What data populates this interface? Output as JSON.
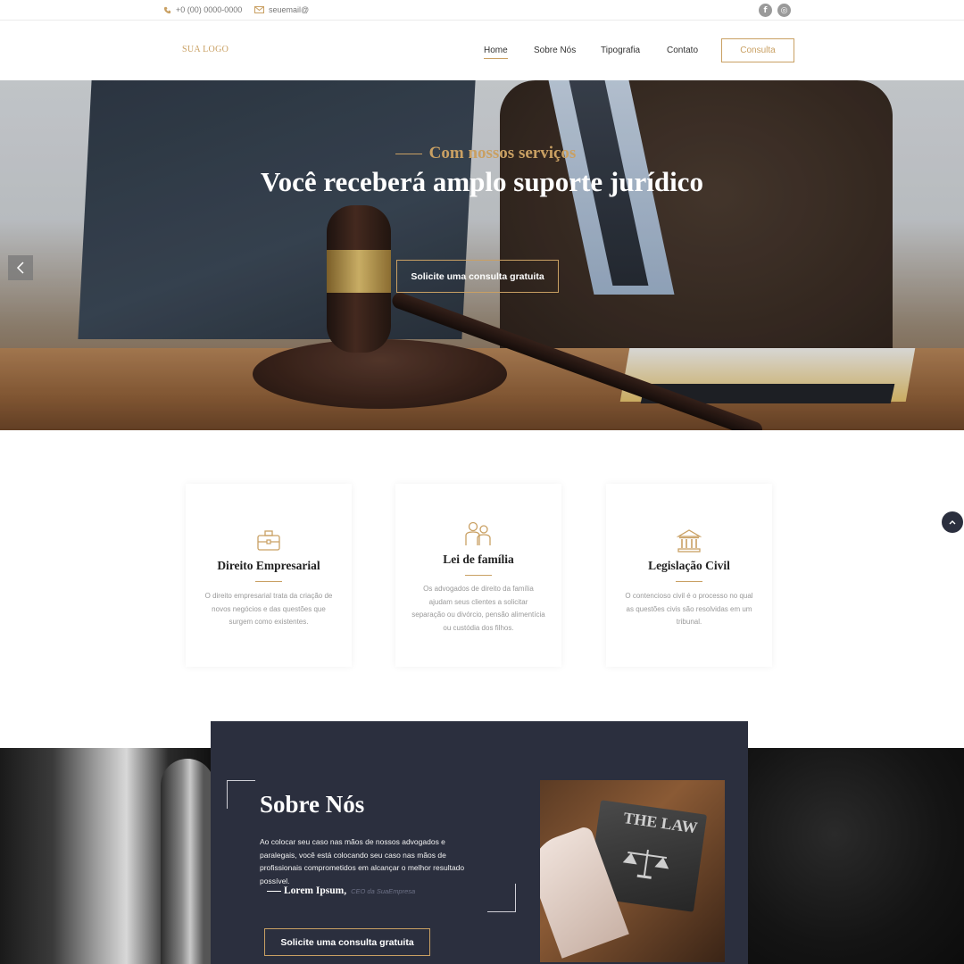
{
  "topbar": {
    "phone": "+0 (00) 0000-0000",
    "email": "seuemail@",
    "social": [
      {
        "icon": "facebook-icon",
        "glyph": "f"
      },
      {
        "icon": "instagram-icon",
        "glyph": "◎"
      }
    ]
  },
  "header": {
    "logo": "SUA LOGO",
    "nav": [
      "Home",
      "Sobre Nós",
      "Tipografia",
      "Contato"
    ],
    "cta": "Consulta"
  },
  "hero": {
    "subtitle": "Com nossos serviços",
    "title": "Você receberá amplo suporte jurídico",
    "button": "Solicite uma consulta gratuita"
  },
  "services": [
    {
      "icon": "briefcase-icon",
      "title": "Direito Empresarial",
      "text": "O direito empresarial trata da criação de novos negócios e das questões que surgem como existentes."
    },
    {
      "icon": "family-icon",
      "title": "Lei de família",
      "text": "Os advogados de direito da família ajudam seus clientes a solicitar separação ou divórcio, pensão alimentícia ou custódia dos filhos."
    },
    {
      "icon": "courthouse-icon",
      "title": "Legislação Civil",
      "text": "O contencioso civil é o processo no qual as questões civis são resolvidas em um tribunal."
    }
  ],
  "about": {
    "title": "Sobre Nós",
    "text": "Ao colocar seu caso nas mãos de nossos advogados e paralegais, você está colocando seu caso nas mãos de profissionais comprometidos em alcançar o melhor resultado possível.",
    "signature_name": "Lorem Ipsum,",
    "signature_role": "CEO da SuaEmpresa",
    "button": "Solicite uma consulta gratuita",
    "book_title": "THE LAW"
  },
  "colors": {
    "accent": "#c9a063",
    "dark": "#2b2f3e"
  }
}
